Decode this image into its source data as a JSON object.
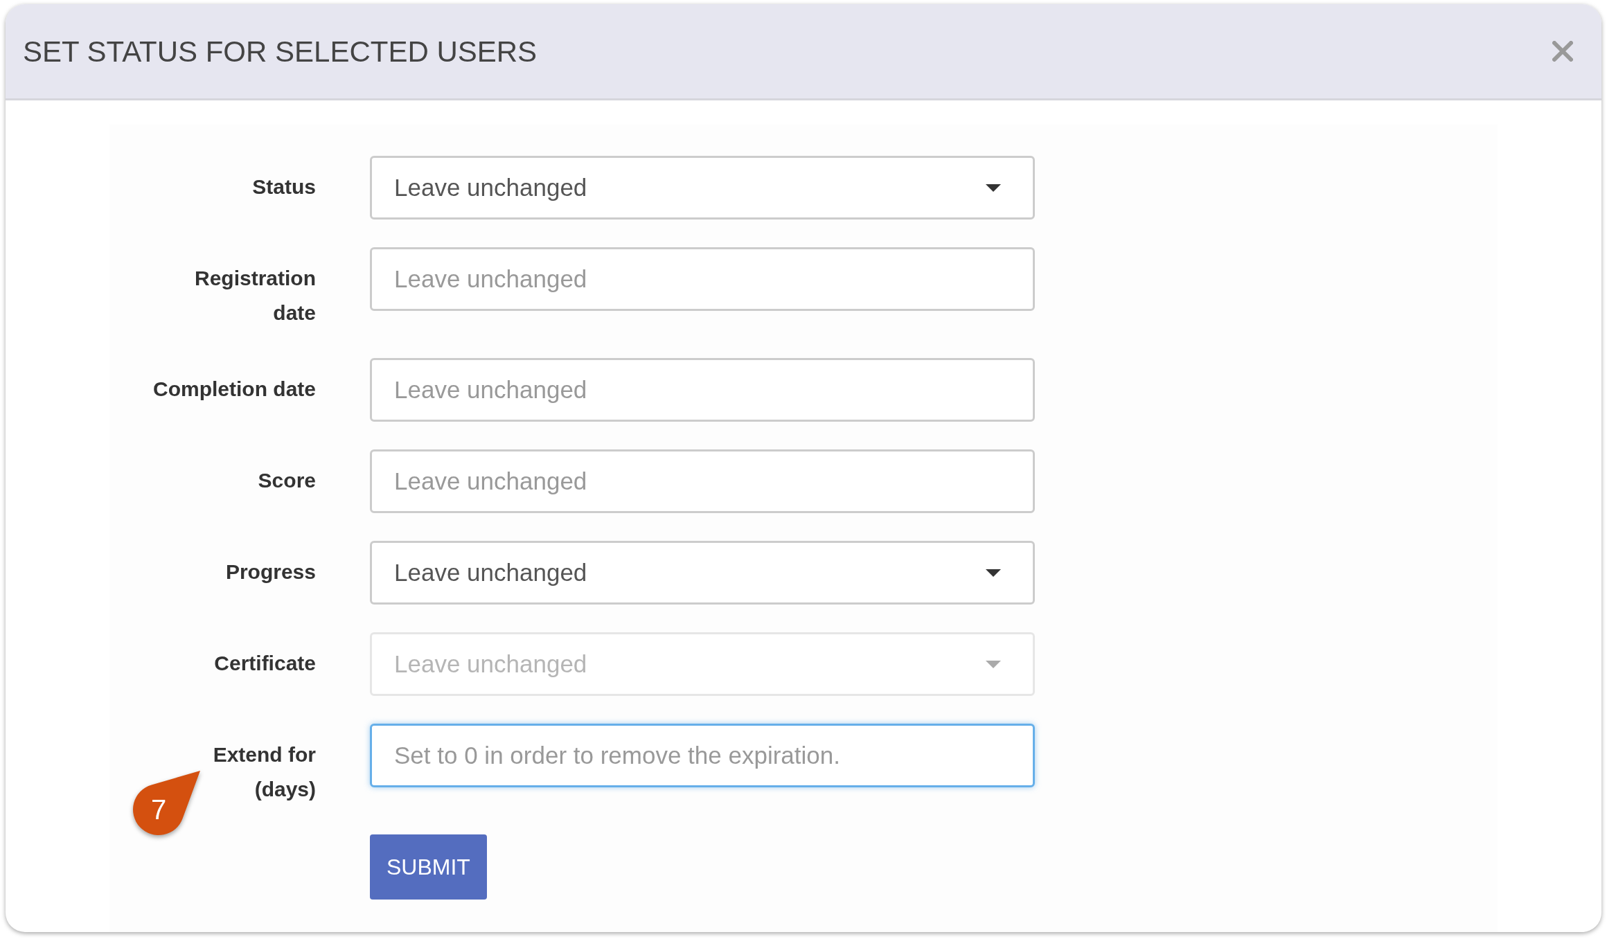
{
  "dialog": {
    "title": "SET STATUS FOR SELECTED USERS"
  },
  "form": {
    "fields": [
      {
        "label": "Status",
        "kind": "select",
        "value": "Leave unchanged",
        "disabled": false,
        "focused": false
      },
      {
        "label": "Registration date",
        "kind": "text",
        "placeholder": "Leave unchanged",
        "disabled": false,
        "focused": false
      },
      {
        "label": "Completion date",
        "kind": "text",
        "placeholder": "Leave unchanged",
        "disabled": false,
        "focused": false
      },
      {
        "label": "Score",
        "kind": "text",
        "placeholder": "Leave unchanged",
        "disabled": false,
        "focused": false
      },
      {
        "label": "Progress",
        "kind": "select",
        "value": "Leave unchanged",
        "disabled": false,
        "focused": false
      },
      {
        "label": "Certificate",
        "kind": "select",
        "value": "Leave unchanged",
        "disabled": true,
        "focused": false
      },
      {
        "label": "Extend for (days)",
        "kind": "text",
        "placeholder": "Set to 0 in order to remove the expiration.",
        "disabled": false,
        "focused": true
      }
    ],
    "submit": "SUBMIT"
  },
  "step_marker": {
    "number": "7"
  }
}
